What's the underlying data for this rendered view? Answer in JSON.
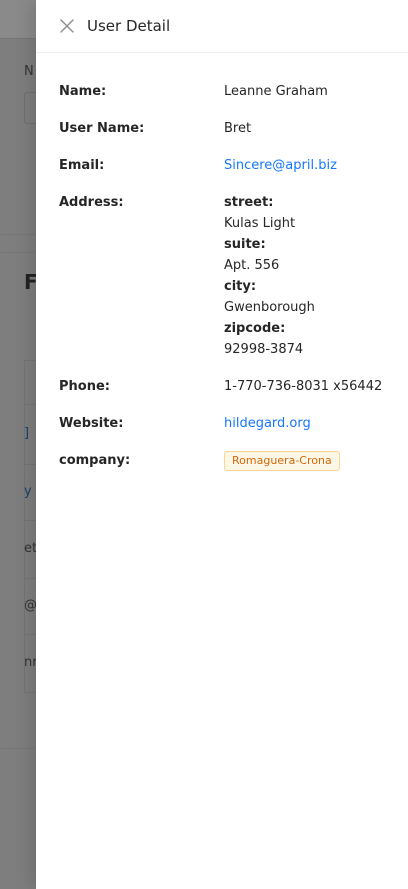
{
  "background": {
    "fragments": [
      {
        "id": "n",
        "text": "N"
      },
      {
        "id": "f",
        "text": "F"
      },
      {
        "id": "link1",
        "text": "]"
      },
      {
        "id": "link2",
        "text": "y ("
      },
      {
        "id": "t1",
        "text": "et"
      },
      {
        "id": "t2",
        "text": "@k"
      },
      {
        "id": "t3",
        "text": "nr"
      }
    ]
  },
  "drawer": {
    "title": "User Detail",
    "fields": {
      "name": {
        "label": "Name:",
        "value": "Leanne Graham"
      },
      "username": {
        "label": "User Name:",
        "value": "Bret"
      },
      "email": {
        "label": "Email:",
        "value": "Sincere@april.biz"
      },
      "address": {
        "label": "Address:",
        "street_key": "street:",
        "street": "Kulas Light",
        "suite_key": "suite:",
        "suite": "Apt. 556",
        "city_key": "city:",
        "city": "Gwenborough",
        "zipcode_key": "zipcode:",
        "zipcode": "92998-3874"
      },
      "phone": {
        "label": "Phone:",
        "value": "1-770-736-8031 x56442"
      },
      "website": {
        "label": "Website:",
        "value": "hildegard.org"
      },
      "company": {
        "label": "company:",
        "value": "Romaguera-Crona"
      }
    }
  },
  "colors": {
    "link": "#1677ff",
    "tag_text": "#d4670a",
    "tag_bg": "#fff7e6",
    "tag_border": "#ffd591"
  },
  "icons": {
    "close": "close-icon"
  }
}
